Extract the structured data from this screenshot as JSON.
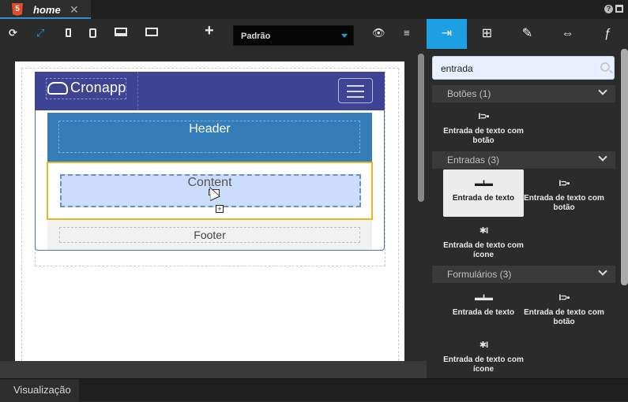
{
  "tab": {
    "title": "home",
    "html_badge": "5",
    "close_glyph": "✕"
  },
  "window": {
    "help_glyph": "?"
  },
  "toolbar": {
    "refresh_glyph": "⟳",
    "fullscreen_glyph": "⤢",
    "add_glyph": "+",
    "device_select_value": "Padrão",
    "visibility_glyph": "👁",
    "datasource_glyph": "≡"
  },
  "right_tools": {
    "components_glyph": "⇥",
    "tree_glyph": "⊞",
    "edit_glyph": "✎",
    "resize_glyph": "⇔",
    "events_glyph": "ƒ"
  },
  "canvas": {
    "brand": "Cronapp",
    "header_label": "Header",
    "content_label": "Content",
    "footer_label": "Footer"
  },
  "status": {
    "tab_label": "Visualização"
  },
  "panel": {
    "search_value": "entrada",
    "groups": [
      {
        "label": "Botões (1)"
      },
      {
        "label": "Entradas (3)"
      },
      {
        "label": "Formulários (3)"
      }
    ],
    "components": {
      "g1_c1": {
        "label": "Entrada de texto com botão",
        "icon": "I⊃▪"
      },
      "g2_c1": {
        "label": "Entrada de texto",
        "icon": "▬I▬"
      },
      "g2_c2": {
        "label": "Entrada de texto com botão",
        "icon": "I⊃▪"
      },
      "g2_c3": {
        "label": "Entrada de texto com ícone",
        "icon": "✱I"
      },
      "g3_c1": {
        "label": "Entrada de texto",
        "icon": "▬I▬"
      },
      "g3_c2": {
        "label": "Entrada de texto com botão",
        "icon": "I⊃▪"
      },
      "g3_c3": {
        "label": "Entrada de texto com ícone",
        "icon": "✱I"
      }
    }
  },
  "colors": {
    "accent": "#1c9fe3",
    "navbar": "#3e4394",
    "header": "#347db8",
    "content_border": "#e1b923",
    "html5": "#e44d26"
  }
}
